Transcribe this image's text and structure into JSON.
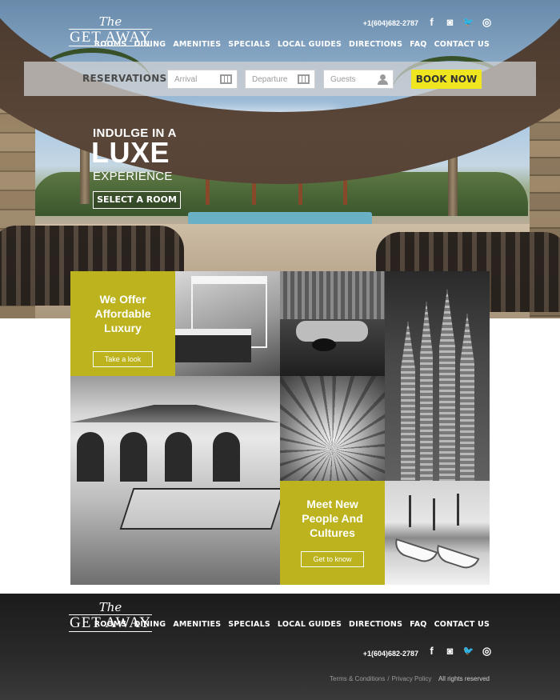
{
  "brand": {
    "the": "The",
    "name": "GET AWAY"
  },
  "header": {
    "phone": "+1(604)682-2787",
    "social": [
      {
        "icon": "facebook-icon",
        "glyph": "f"
      },
      {
        "icon": "instagram-icon",
        "glyph": "◙"
      },
      {
        "icon": "twitter-icon",
        "glyph": "🐦"
      },
      {
        "icon": "tripadvisor-icon",
        "glyph": "◎"
      }
    ],
    "nav": [
      "ROOMS",
      "DINING",
      "AMENITIES",
      "SPECIALS",
      "LOCAL GUIDES",
      "DIRECTIONS",
      "FAQ",
      "CONTACT US"
    ]
  },
  "reservation": {
    "label": "RESERVATIONS",
    "arrival_placeholder": "Arrival",
    "departure_placeholder": "Departure",
    "guests_placeholder": "Guests",
    "book_label": "BOOK NOW"
  },
  "hero": {
    "line1": "INDULGE IN A",
    "line2": "LUXE",
    "line3": "EXPERIENCE",
    "cta": "SELECT A ROOM"
  },
  "promos": {
    "first": {
      "title": "We Offer Affordable Luxury",
      "button": "Take a look"
    },
    "second": {
      "title": "Meet New People And Cultures",
      "button": "Get to know"
    }
  },
  "footer": {
    "nav": [
      "ROOMS",
      "DINING",
      "AMENITIES",
      "SPECIALS",
      "LOCAL GUIDES",
      "DIRECTIONS",
      "FAQ",
      "CONTACT US"
    ],
    "phone": "+1(604)682-2787",
    "terms": "Terms & Conditions",
    "separator": "/",
    "privacy": "Privacy Policy",
    "rights": "All rights reserved"
  },
  "colors": {
    "accent": "#f0e620",
    "promo": "#bcb31f",
    "footer": "#222222"
  }
}
